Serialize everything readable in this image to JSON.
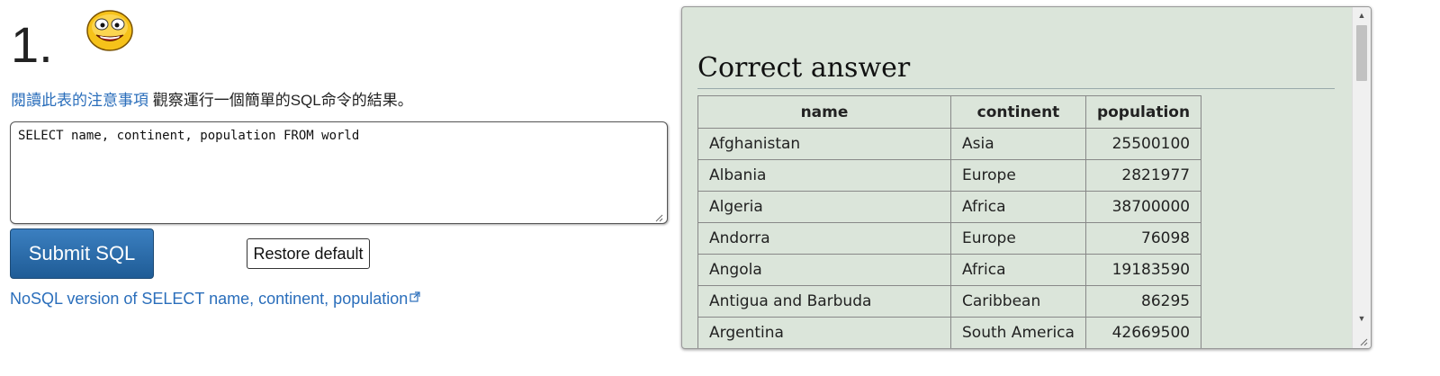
{
  "question": {
    "number": "1.",
    "icon": "smiley-icon"
  },
  "instruction": {
    "link_text": "閱讀此表的注意事項",
    "text": " 觀察運行一個簡單的SQL命令的結果。"
  },
  "editor": {
    "value": "SELECT name, continent, population FROM world"
  },
  "buttons": {
    "submit_label": "Submit SQL",
    "restore_label": "Restore default"
  },
  "nosql_link": {
    "text": "NoSQL version of SELECT name, continent, population",
    "icon": "external-link-icon"
  },
  "answer": {
    "title": "Correct answer",
    "columns": [
      "name",
      "continent",
      "population"
    ],
    "rows": [
      [
        "Afghanistan",
        "Asia",
        "25500100"
      ],
      [
        "Albania",
        "Europe",
        "2821977"
      ],
      [
        "Algeria",
        "Africa",
        "38700000"
      ],
      [
        "Andorra",
        "Europe",
        "76098"
      ],
      [
        "Angola",
        "Africa",
        "19183590"
      ],
      [
        "Antigua and Barbuda",
        "Caribbean",
        "86295"
      ],
      [
        "Argentina",
        "South America",
        "42669500"
      ]
    ]
  },
  "colors": {
    "link": "#2a6ebb",
    "submit_button": "#2a6ba8",
    "answer_panel_bg": "#dbe5da"
  }
}
